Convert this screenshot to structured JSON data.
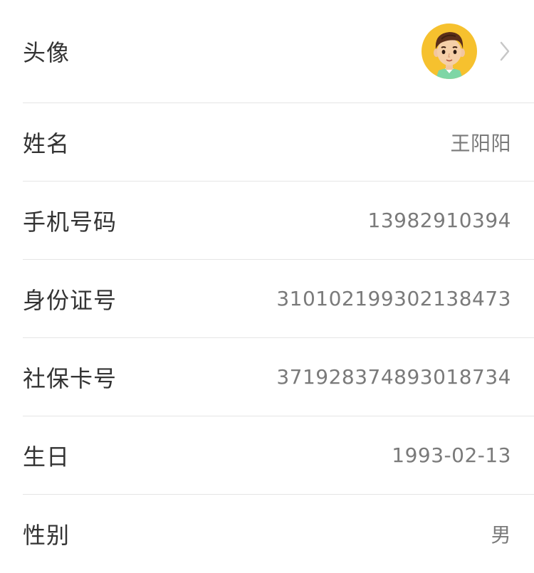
{
  "profile": {
    "rows": [
      {
        "label": "头像"
      },
      {
        "label": "姓名",
        "value": "王阳阳"
      },
      {
        "label": "手机号码",
        "value": "13982910394"
      },
      {
        "label": "身份证号",
        "value": "310102199302138473"
      },
      {
        "label": "社保卡号",
        "value": "371928374893018734"
      },
      {
        "label": "生日",
        "value": "1993-02-13"
      },
      {
        "label": "性别",
        "value": "男"
      }
    ]
  },
  "colors": {
    "avatar_bg": "#f6c12e",
    "divider": "#e5e5e5",
    "label_text": "#333333",
    "value_text": "#7a7a7a"
  },
  "icons": {
    "avatar": "avatar-cartoon-man",
    "chevron": "chevron-right-icon"
  }
}
